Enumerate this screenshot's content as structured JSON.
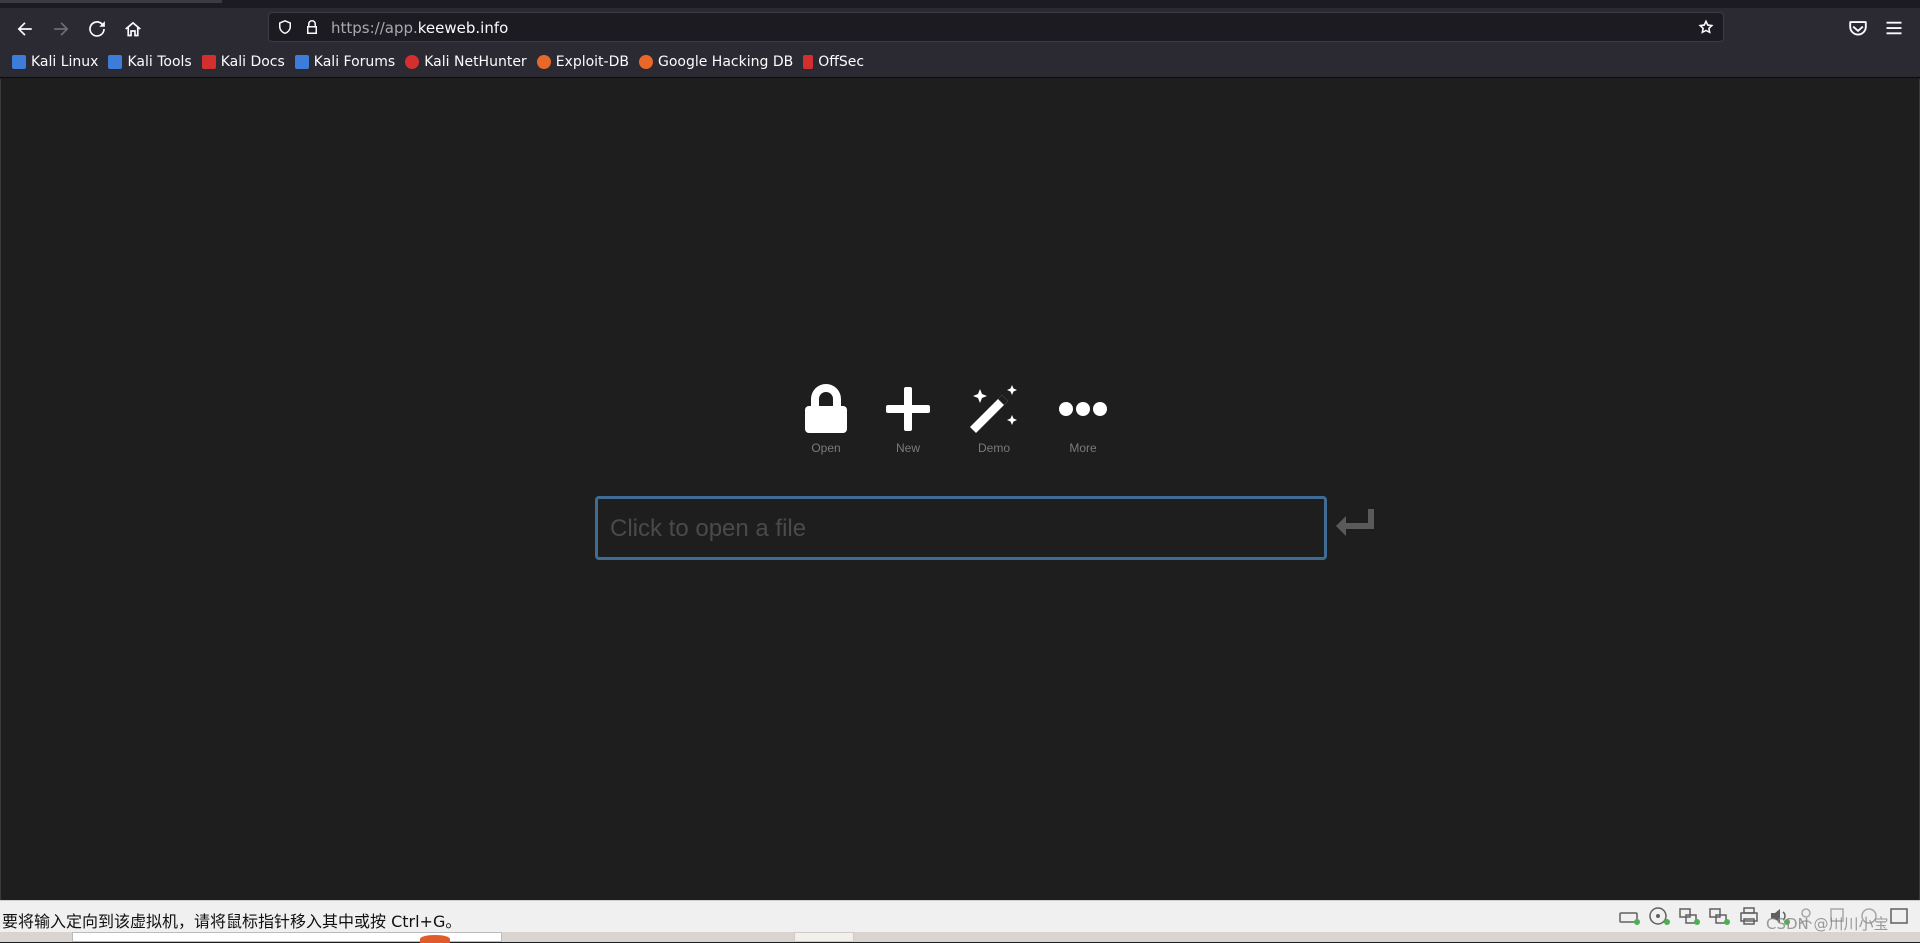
{
  "browser": {
    "url_prefix": "https://app.",
    "url_domain": "keeweb.info",
    "bookmarks": [
      {
        "label": "Kali Linux",
        "color": "#3b7dd8"
      },
      {
        "label": "Kali Tools",
        "color": "#3b7dd8"
      },
      {
        "label": "Kali Docs",
        "color": "#d32f2f"
      },
      {
        "label": "Kali Forums",
        "color": "#3b7dd8"
      },
      {
        "label": "Kali NetHunter",
        "color": "#d32f2f"
      },
      {
        "label": "Exploit-DB",
        "color": "#e8682a"
      },
      {
        "label": "Google Hacking DB",
        "color": "#e8682a"
      },
      {
        "label": "OffSec",
        "color": "#d32f2f"
      }
    ]
  },
  "app": {
    "actions": [
      {
        "label": "Open",
        "icon": "lock-icon"
      },
      {
        "label": "New",
        "icon": "plus-icon"
      },
      {
        "label": "Demo",
        "icon": "magic-wand-icon"
      },
      {
        "label": "More",
        "icon": "ellipsis-icon"
      }
    ],
    "open_placeholder": "Click to open a file",
    "accent_color": "#3f6c93"
  },
  "vm": {
    "message": "要将输入定向到该虚拟机，请将鼠标指针移入其中或按 Ctrl+G。",
    "watermark": "CSDN @川川小宝"
  }
}
